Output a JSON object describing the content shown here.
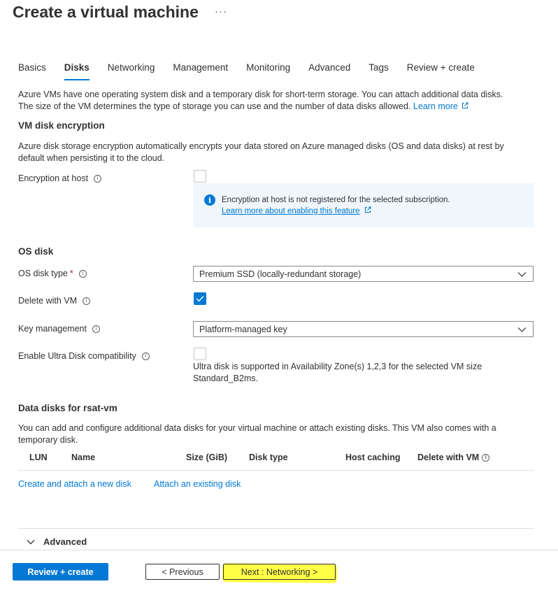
{
  "page": {
    "title": "Create a virtual machine",
    "more": "···"
  },
  "tabs": [
    {
      "label": "Basics"
    },
    {
      "label": "Disks"
    },
    {
      "label": "Networking"
    },
    {
      "label": "Management"
    },
    {
      "label": "Monitoring"
    },
    {
      "label": "Advanced"
    },
    {
      "label": "Tags"
    },
    {
      "label": "Review + create"
    }
  ],
  "intro": {
    "line1": "Azure VMs have one operating system disk and a temporary disk for short-term storage. You can attach additional data disks.",
    "line2": "The size of the VM determines the type of storage you can use and the number of data disks allowed.",
    "learn_more": "Learn more"
  },
  "encryption": {
    "heading": "VM disk encryption",
    "desc_line1": "Azure disk storage encryption automatically encrypts your data stored on Azure managed disks (OS and data disks) at rest by",
    "desc_line2": "default when persisting it to the cloud.",
    "host_label": "Encryption at host",
    "info_message": "Encryption at host is not registered for the selected subscription.",
    "info_link": "Learn more about enabling this feature"
  },
  "os_disk": {
    "heading": "OS disk",
    "type_label": "OS disk type",
    "required_mark": "*",
    "type_value": "Premium SSD (locally-redundant storage)",
    "delete_label": "Delete with VM",
    "delete_checked": true,
    "key_label": "Key management",
    "key_value": "Platform-managed key",
    "ultra_label": "Enable Ultra Disk compatibility",
    "ultra_hint_line1": "Ultra disk is supported in Availability Zone(s) 1,2,3 for the selected VM size",
    "ultra_hint_line2": "Standard_B2ms."
  },
  "data_disks": {
    "heading": "Data disks for rsat-vm",
    "desc_line1": "You can add and configure additional data disks for your virtual machine or attach existing disks. This VM also comes with a",
    "desc_line2": "temporary disk.",
    "columns": {
      "lun": "LUN",
      "name": "Name",
      "size": "Size (GiB)",
      "type": "Disk type",
      "caching": "Host caching",
      "delete": "Delete with VM"
    },
    "create_link": "Create and attach a new disk",
    "attach_link": "Attach an existing disk"
  },
  "advanced": {
    "label": "Advanced"
  },
  "footer": {
    "review_create": "Review + create",
    "previous": "< Previous",
    "next": "Next : Networking >"
  },
  "colors": {
    "accent": "#0078d4",
    "highlight": "#ffff00",
    "info_bg": "#eff6fc",
    "required": "#a4262c"
  },
  "icons": {
    "info": "info-circle-icon",
    "external": "external-link-icon",
    "chevron": "chevron-down-icon",
    "check": "checkmark-icon"
  }
}
